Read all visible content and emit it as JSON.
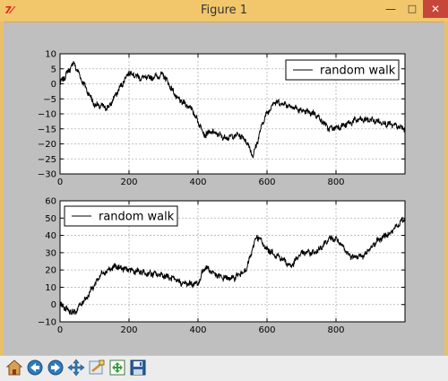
{
  "window": {
    "title": "Figure 1",
    "app_icon_glyph": "7⁄",
    "min_glyph": "—",
    "max_glyph": "□",
    "close_glyph": "✕"
  },
  "toolbar": {
    "icons": [
      "home-icon",
      "back-icon",
      "forward-icon",
      "pan-icon",
      "zoom-icon",
      "subplots-icon",
      "save-icon"
    ]
  },
  "colors": {
    "line": "#000000",
    "grid": "#b0b0b0",
    "background": "#bfbfbf",
    "titlebar": "#f2c76c",
    "close_button": "#c7463a"
  },
  "chart_data": [
    {
      "type": "line",
      "grid": true,
      "legend_position": "top-right",
      "series": [
        {
          "name": "random walk",
          "length": 1000
        }
      ],
      "x": [
        0,
        40,
        60,
        100,
        140,
        200,
        230,
        260,
        300,
        340,
        380,
        420,
        440,
        480,
        520,
        540,
        560,
        590,
        620,
        660,
        700,
        740,
        780,
        820,
        860,
        900,
        940,
        1000
      ],
      "y": [
        0,
        7,
        2,
        -7,
        -8,
        4,
        2,
        2,
        3,
        -5,
        -8,
        -17,
        -16,
        -18,
        -17,
        -19,
        -24,
        -12,
        -6,
        -7,
        -9,
        -10,
        -15,
        -14,
        -12,
        -12,
        -13,
        -15
      ],
      "xlim": [
        0,
        1000
      ],
      "ylim": [
        -30,
        10
      ],
      "xticks": [
        "0",
        "200",
        "400",
        "600",
        "800"
      ],
      "yticks": [
        "10",
        "5",
        "0",
        "−5",
        "−10",
        "−15",
        "−20",
        "−25",
        "−30"
      ]
    },
    {
      "type": "line",
      "grid": true,
      "legend_position": "top-left",
      "series": [
        {
          "name": "random walk",
          "length": 1000
        }
      ],
      "x": [
        0,
        40,
        80,
        120,
        160,
        200,
        250,
        300,
        360,
        400,
        420,
        460,
        500,
        540,
        570,
        600,
        640,
        670,
        700,
        740,
        780,
        800,
        840,
        880,
        920,
        960,
        1000
      ],
      "y": [
        0,
        -5,
        5,
        18,
        22,
        20,
        18,
        17,
        12,
        12,
        22,
        16,
        15,
        20,
        40,
        32,
        27,
        22,
        30,
        30,
        38,
        38,
        28,
        28,
        37,
        42,
        50
      ],
      "xlim": [
        0,
        1000
      ],
      "ylim": [
        -10,
        60
      ],
      "xticks": [
        "0",
        "200",
        "400",
        "600",
        "800"
      ],
      "yticks": [
        "60",
        "50",
        "40",
        "30",
        "20",
        "10",
        "0",
        "−10"
      ]
    }
  ]
}
